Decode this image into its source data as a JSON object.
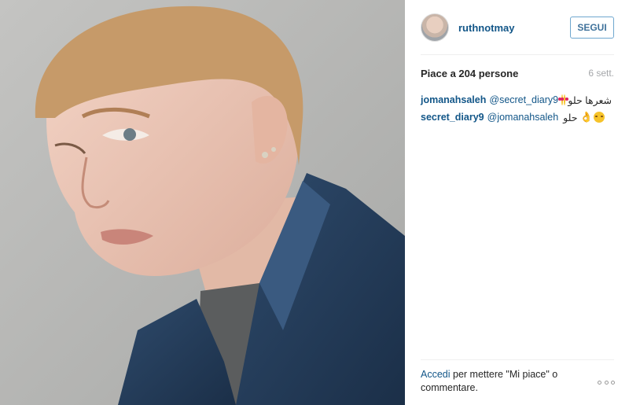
{
  "post": {
    "image_icon": "portrait-photo"
  },
  "header": {
    "username": "ruthnotmay",
    "follow_label": "SEGUI"
  },
  "stats": {
    "likes": "Piace a 204 persone",
    "time": "6 sett."
  },
  "comments": [
    {
      "user": "jomanahsaleh",
      "mention": "@secret_diary9",
      "text": "شعرها حلو",
      "emoji": "heart-eyes-emoji"
    },
    {
      "user": "secret_diary9",
      "mention": "@jomanahsaleh",
      "text": "حلو",
      "emoji": "ok-hand-emoji"
    }
  ],
  "footer": {
    "login_link": "Accedi",
    "text": "per mettere \"Mi piace\" o commentare.",
    "more_icon": "more-options-icon"
  },
  "colors": {
    "link": "#125688",
    "follow_border": "#6fa7cf",
    "divider": "#efefef",
    "muted": "#a5a7aa"
  }
}
